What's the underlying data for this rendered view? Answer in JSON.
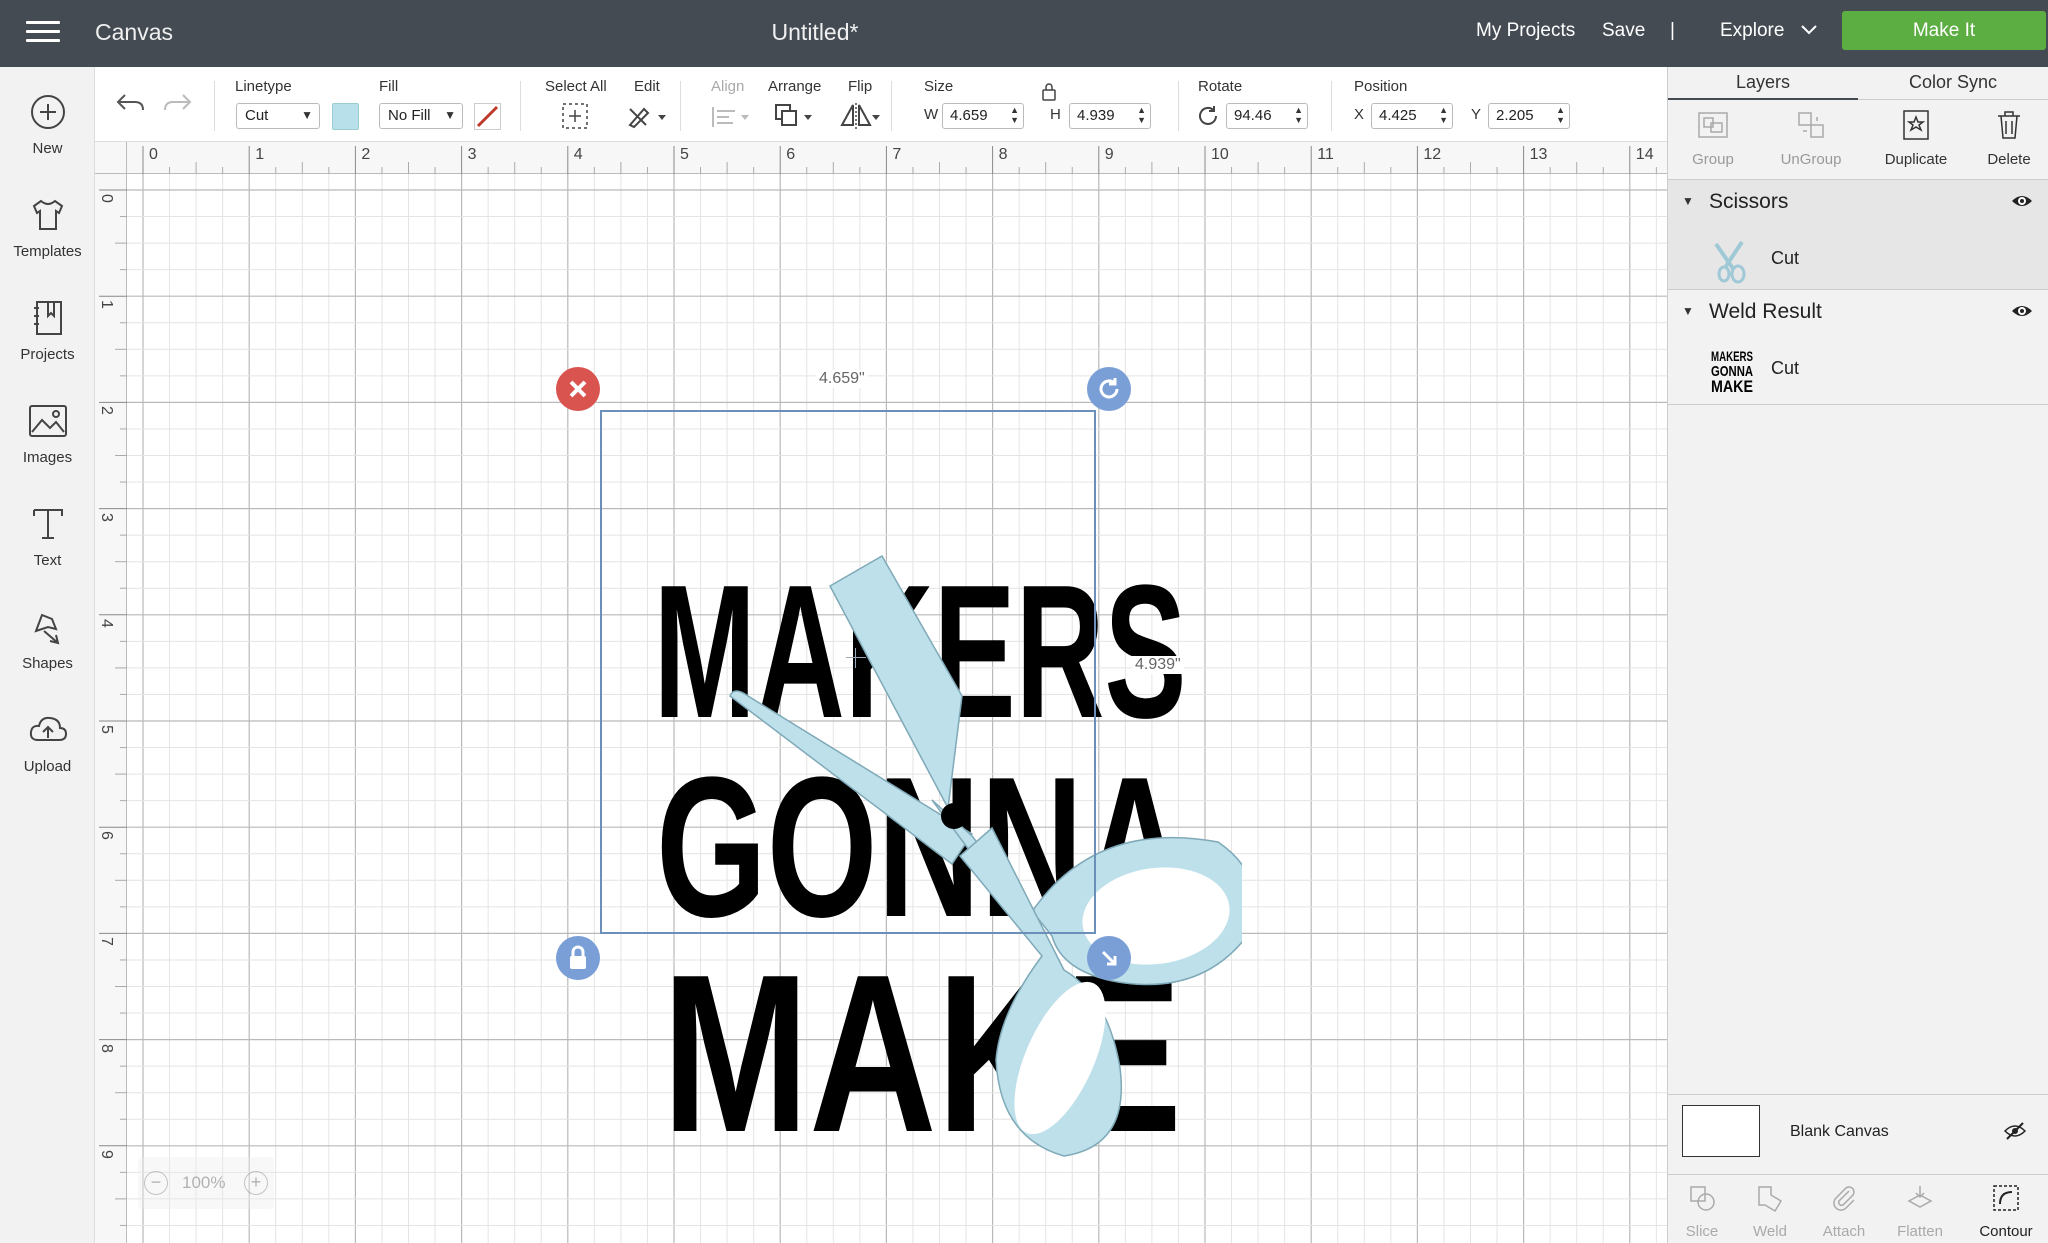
{
  "topbar": {
    "app_title": "Canvas",
    "doc_title": "Untitled*",
    "my_projects": "My Projects",
    "save": "Save",
    "divider": "|",
    "explore": "Explore",
    "make_it": "Make It"
  },
  "leftnav": {
    "items": [
      {
        "label": "New",
        "icon": "plus-circle-icon"
      },
      {
        "label": "Templates",
        "icon": "tshirt-icon"
      },
      {
        "label": "Projects",
        "icon": "notebook-icon"
      },
      {
        "label": "Images",
        "icon": "image-icon"
      },
      {
        "label": "Text",
        "icon": "text-icon"
      },
      {
        "label": "Shapes",
        "icon": "shapes-icon"
      },
      {
        "label": "Upload",
        "icon": "upload-cloud-icon"
      }
    ]
  },
  "toolbar": {
    "linetype_label": "Linetype",
    "linetype_value": "Cut",
    "linetype_color": "#b7e0ea",
    "fill_label": "Fill",
    "fill_value": "No Fill",
    "select_all_label": "Select All",
    "edit_label": "Edit",
    "align_label": "Align",
    "arrange_label": "Arrange",
    "flip_label": "Flip",
    "size_label": "Size",
    "w_label": "W",
    "w_value": "4.659",
    "h_label": "H",
    "h_value": "4.939",
    "rotate_label": "Rotate",
    "rotate_value": "94.46",
    "position_label": "Position",
    "x_label": "X",
    "x_value": "4.425",
    "y_label": "Y",
    "y_value": "2.205"
  },
  "ruler": {
    "top": [
      "0",
      "1",
      "2",
      "3",
      "4",
      "5",
      "6",
      "7",
      "8",
      "9",
      "10",
      "11",
      "12",
      "13",
      "14"
    ],
    "left": [
      "0",
      "1",
      "2",
      "3",
      "4",
      "5",
      "6",
      "7",
      "8",
      "9"
    ]
  },
  "canvas": {
    "width_dim": "4.659\"",
    "height_dim": "4.939\"",
    "design_lines": [
      "MAKERS",
      "GONNA",
      "MAKE"
    ],
    "scissors_color": "#bde0ea",
    "zoom": "100%"
  },
  "panel": {
    "tabs": [
      "Layers",
      "Color Sync"
    ],
    "tools": [
      {
        "label": "Group",
        "enabled": false
      },
      {
        "label": "UnGroup",
        "enabled": false
      },
      {
        "label": "Duplicate",
        "enabled": true
      },
      {
        "label": "Delete",
        "enabled": true
      }
    ],
    "layers": [
      {
        "name": "Scissors",
        "row_label": "Cut"
      },
      {
        "name": "Weld Result",
        "row_label": "Cut",
        "thumb_text": [
          "MAKERS",
          "GONNA",
          "MAKE"
        ]
      }
    ],
    "blank_canvas": "Blank Canvas",
    "bottom_tools": [
      {
        "label": "Slice",
        "enabled": false
      },
      {
        "label": "Weld",
        "enabled": false
      },
      {
        "label": "Attach",
        "enabled": false
      },
      {
        "label": "Flatten",
        "enabled": false
      },
      {
        "label": "Contour",
        "enabled": true
      }
    ]
  },
  "colors": {
    "topbar": "#444b53",
    "make_it": "#5cae43",
    "delete_handle": "#d9534f",
    "handle_blue": "#7a9ed6"
  }
}
